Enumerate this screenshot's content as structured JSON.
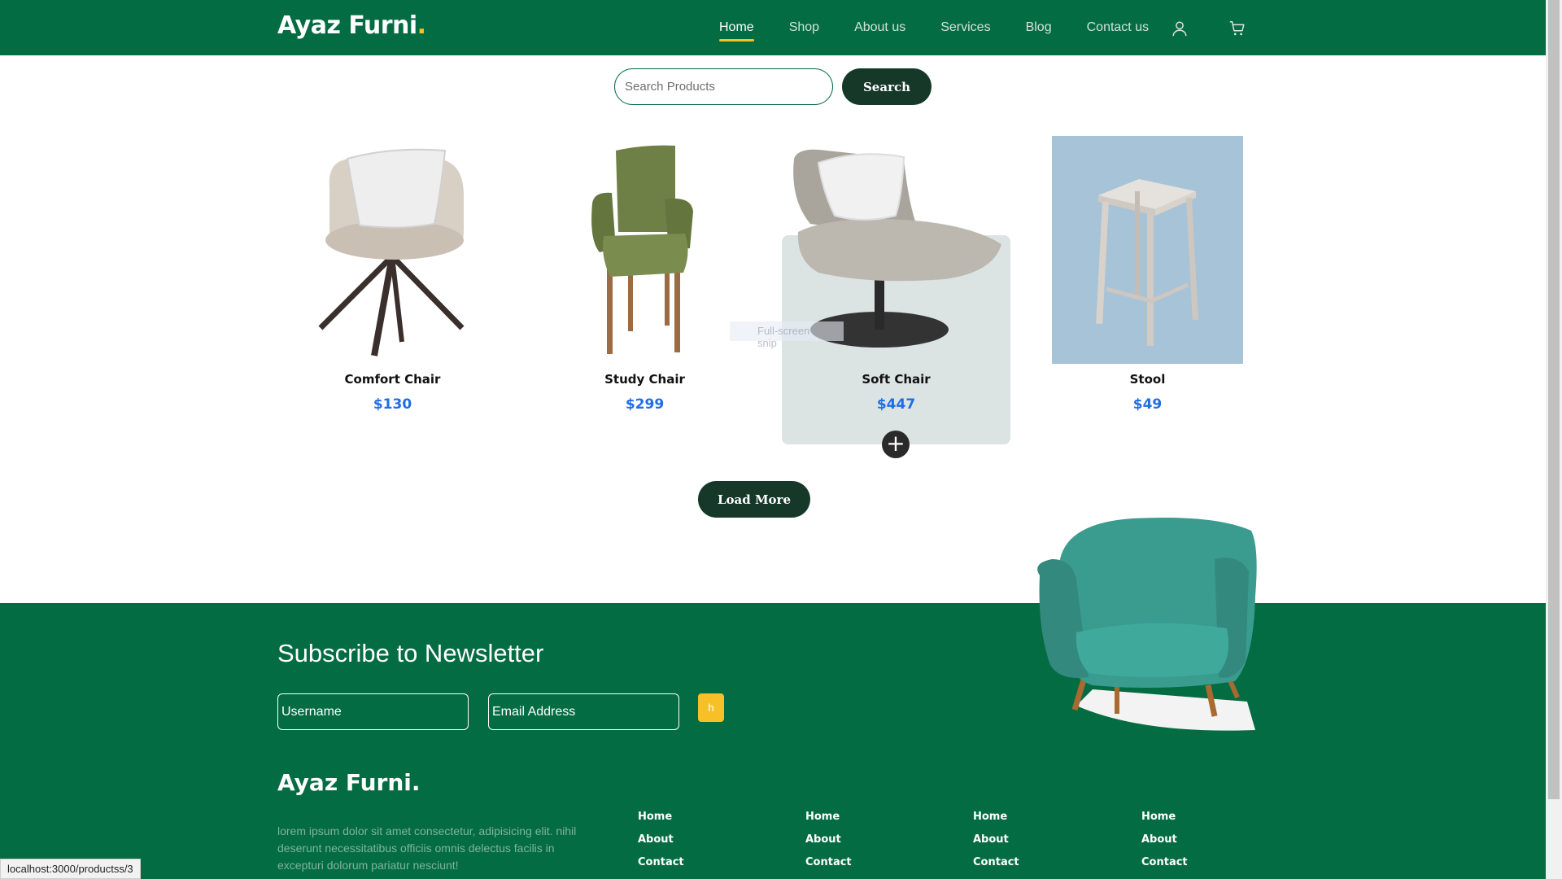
{
  "header": {
    "brand": "Ayaz Furni",
    "brand_dot": ".",
    "nav": [
      "Home",
      "Shop",
      "About us",
      "Services",
      "Blog",
      "Contact us"
    ],
    "active": "Home"
  },
  "search": {
    "placeholder": "Search Products",
    "button": "Search"
  },
  "products": [
    {
      "name": "Comfort Chair",
      "price": "$130"
    },
    {
      "name": "Study Chair",
      "price": "$299"
    },
    {
      "name": "Soft Chair",
      "price": "$447"
    },
    {
      "name": "Stool",
      "price": "$49"
    }
  ],
  "tooltip": "Full-screen snip",
  "load_more": "Load More",
  "newsletter": {
    "title": "Subscribe to Newsletter",
    "username_placeholder": "Username",
    "email_placeholder": "Email Address",
    "button": "h"
  },
  "footer": {
    "brand": "Ayaz Furni.",
    "text": "lorem ipsum dolor sit amet consectetur, adipisicing elit. nihil deserunt necessitatibus officiis omnis delectus facilis in excepturi dolorum pariatur nesciunt!",
    "columns": [
      [
        "Home",
        "About",
        "Contact"
      ],
      [
        "Home",
        "About",
        "Contact"
      ],
      [
        "Home",
        "About",
        "Contact"
      ],
      [
        "Home",
        "About",
        "Contact"
      ]
    ]
  },
  "status_url": "localhost:3000/productss/3",
  "colors": {
    "primary": "#046c43",
    "accent": "#f6c026",
    "price": "#1e6ee8",
    "dark_button": "#163828"
  }
}
